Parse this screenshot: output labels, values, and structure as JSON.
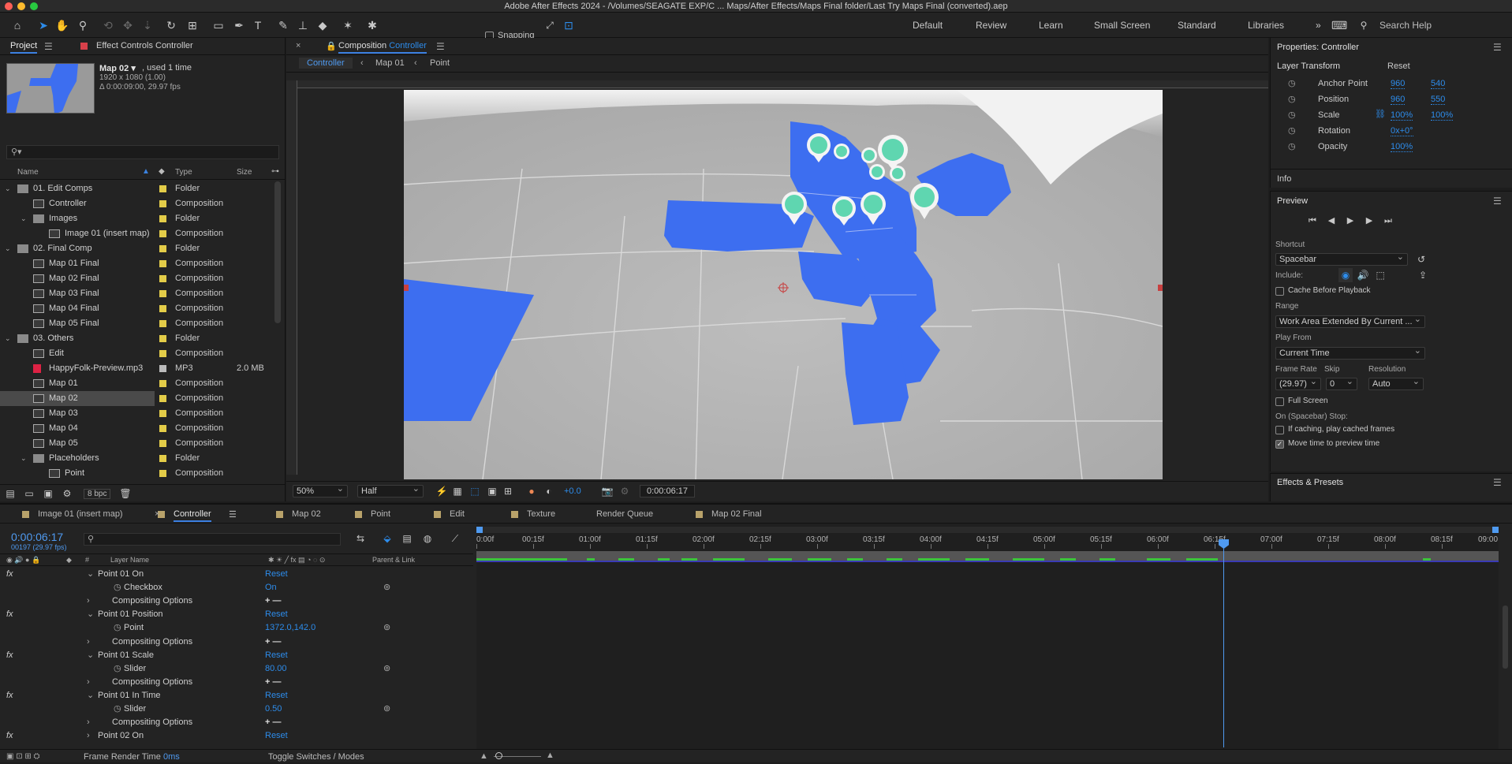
{
  "window": {
    "title": "Adobe After Effects 2024 - /Volumes/SEAGATE EXP/C ... Maps/After Effects/Maps Final folder/Last Try Maps Final (converted).aep"
  },
  "toolbar": {
    "snapping_label": "Snapping",
    "workspaces": [
      "Default",
      "Review",
      "Learn",
      "Small Screen",
      "Standard",
      "Libraries"
    ],
    "search_placeholder": "Search Help"
  },
  "project": {
    "tab_label": "Project",
    "effect_controls_label": "Effect Controls Controller",
    "thumb": {
      "name": "Map 02 ▾",
      "used": ", used 1 time",
      "dims": "1920 x 1080 (1.00)",
      "duration": "Δ 0:00:09:00, 29.97 fps"
    },
    "columns": {
      "name": "Name",
      "type": "Type",
      "size": "Size"
    },
    "items": [
      {
        "name": "01. Edit Comps",
        "type": "Folder",
        "size": "",
        "indent": 0,
        "kind": "folder",
        "arrow": "open"
      },
      {
        "name": "Controller",
        "type": "Composition",
        "size": "",
        "indent": 1,
        "kind": "comp",
        "arrow": ""
      },
      {
        "name": "Images",
        "type": "Folder",
        "size": "",
        "indent": 1,
        "kind": "folder",
        "arrow": "open"
      },
      {
        "name": "Image 01 (insert map)",
        "type": "Composition",
        "size": "",
        "indent": 2,
        "kind": "comp",
        "arrow": ""
      },
      {
        "name": "02. Final Comp",
        "type": "Folder",
        "size": "",
        "indent": 0,
        "kind": "folder",
        "arrow": "open"
      },
      {
        "name": "Map 01 Final",
        "type": "Composition",
        "size": "",
        "indent": 1,
        "kind": "comp",
        "arrow": ""
      },
      {
        "name": "Map 02 Final",
        "type": "Composition",
        "size": "",
        "indent": 1,
        "kind": "comp",
        "arrow": ""
      },
      {
        "name": "Map 03 Final",
        "type": "Composition",
        "size": "",
        "indent": 1,
        "kind": "comp",
        "arrow": ""
      },
      {
        "name": "Map 04 Final",
        "type": "Composition",
        "size": "",
        "indent": 1,
        "kind": "comp",
        "arrow": ""
      },
      {
        "name": "Map 05 Final",
        "type": "Composition",
        "size": "",
        "indent": 1,
        "kind": "comp",
        "arrow": ""
      },
      {
        "name": "03. Others",
        "type": "Folder",
        "size": "",
        "indent": 0,
        "kind": "folder",
        "arrow": "open"
      },
      {
        "name": "Edit",
        "type": "Composition",
        "size": "",
        "indent": 1,
        "kind": "comp",
        "arrow": ""
      },
      {
        "name": "HappyFolk-Preview.mp3",
        "type": "MP3",
        "size": "2.0 MB",
        "indent": 1,
        "kind": "audio",
        "arrow": ""
      },
      {
        "name": "Map 01",
        "type": "Composition",
        "size": "",
        "indent": 1,
        "kind": "comp",
        "arrow": ""
      },
      {
        "name": "Map 02",
        "type": "Composition",
        "size": "",
        "indent": 1,
        "kind": "comp",
        "arrow": "",
        "selected": true
      },
      {
        "name": "Map 03",
        "type": "Composition",
        "size": "",
        "indent": 1,
        "kind": "comp",
        "arrow": ""
      },
      {
        "name": "Map 04",
        "type": "Composition",
        "size": "",
        "indent": 1,
        "kind": "comp",
        "arrow": ""
      },
      {
        "name": "Map 05",
        "type": "Composition",
        "size": "",
        "indent": 1,
        "kind": "comp",
        "arrow": ""
      },
      {
        "name": "Placeholders",
        "type": "Folder",
        "size": "",
        "indent": 1,
        "kind": "folder",
        "arrow": "open"
      },
      {
        "name": "Point",
        "type": "Composition",
        "size": "",
        "indent": 2,
        "kind": "comp",
        "arrow": ""
      }
    ],
    "bpc": "8 bpc"
  },
  "composition": {
    "tab_prefix": "Composition",
    "tab_name": "Controller",
    "breadcrumbs": [
      "Controller",
      "Map 01",
      "Point"
    ],
    "zoom": "50%",
    "resolution": "Half",
    "exposure": "+0.0",
    "timecode": "0:00:06:17"
  },
  "properties": {
    "title": "Properties: Controller",
    "section": "Layer Transform",
    "reset": "Reset",
    "rows": [
      {
        "label": "Anchor Point",
        "v1": "960",
        "v2": "540"
      },
      {
        "label": "Position",
        "v1": "960",
        "v2": "550"
      },
      {
        "label": "Scale",
        "v1": "100%",
        "v2": "100%"
      },
      {
        "label": "Rotation",
        "v1": "0x+0°",
        "v2": ""
      },
      {
        "label": "Opacity",
        "v1": "100%",
        "v2": ""
      }
    ],
    "info_label": "Info"
  },
  "preview": {
    "title": "Preview",
    "shortcut_label": "Shortcut",
    "shortcut_value": "Spacebar",
    "include_label": "Include:",
    "cache_label": "Cache Before Playback",
    "range_label": "Range",
    "range_value": "Work Area Extended By Current ...",
    "play_from_label": "Play From",
    "play_from_value": "Current Time",
    "frame_rate_label": "Frame Rate",
    "skip_label": "Skip",
    "resolution_label": "Resolution",
    "frame_rate_value": "(29.97)",
    "skip_value": "0",
    "resolution_value": "Auto",
    "full_screen_label": "Full Screen",
    "stop_label": "On (Spacebar) Stop:",
    "caching_label": "If caching, play cached frames",
    "move_time_label": "Move time to preview time",
    "effects_label": "Effects & Presets"
  },
  "timeline": {
    "tabs": [
      "Image 01 (insert map)",
      "Controller",
      "Map 02",
      "Point",
      "Edit",
      "Texture",
      "Render Queue",
      "Map 02 Final"
    ],
    "current_time": "0:00:06:17",
    "frame_info": "00197 (29.97 fps)",
    "columns": {
      "layer_name": "Layer Name",
      "parent": "Parent & Link"
    },
    "ruler": [
      "0:00f",
      "00:15f",
      "01:00f",
      "01:15f",
      "02:00f",
      "02:15f",
      "03:00f",
      "03:15f",
      "04:00f",
      "04:15f",
      "05:00f",
      "05:15f",
      "06:00f",
      "06:15f",
      "07:00f",
      "07:15f",
      "08:00f",
      "08:15f",
      "09:00"
    ],
    "rows": [
      {
        "fx": true,
        "indent": 1,
        "arrow": "open",
        "name": "Point 01 On",
        "value": "Reset",
        "link": false
      },
      {
        "fx": false,
        "indent": 2,
        "arrow": "stopwatch",
        "name": "Checkbox",
        "value": "On",
        "link": true
      },
      {
        "fx": false,
        "indent": 1,
        "arrow": "closed",
        "name": "Compositing Options",
        "value": "+ —",
        "link": false
      },
      {
        "fx": true,
        "indent": 1,
        "arrow": "open",
        "name": "Point 01 Position",
        "value": "Reset",
        "link": false
      },
      {
        "fx": false,
        "indent": 2,
        "arrow": "stopwatch",
        "name": "Point",
        "value": "1372.0,142.0",
        "link": true
      },
      {
        "fx": false,
        "indent": 1,
        "arrow": "closed",
        "name": "Compositing Options",
        "value": "+ —",
        "link": false
      },
      {
        "fx": true,
        "indent": 1,
        "arrow": "open",
        "name": "Point 01 Scale",
        "value": "Reset",
        "link": false
      },
      {
        "fx": false,
        "indent": 2,
        "arrow": "stopwatch",
        "name": "Slider",
        "value": "80.00",
        "link": true
      },
      {
        "fx": false,
        "indent": 1,
        "arrow": "closed",
        "name": "Compositing Options",
        "value": "+ —",
        "link": false
      },
      {
        "fx": true,
        "indent": 1,
        "arrow": "open",
        "name": "Point 01 In Time",
        "value": "Reset",
        "link": false
      },
      {
        "fx": false,
        "indent": 2,
        "arrow": "stopwatch",
        "name": "Slider",
        "value": "0.50",
        "link": true
      },
      {
        "fx": false,
        "indent": 1,
        "arrow": "closed",
        "name": "Compositing Options",
        "value": "+ —",
        "link": false
      },
      {
        "fx": true,
        "indent": 1,
        "arrow": "closed",
        "name": "Point 02 On",
        "value": "Reset",
        "link": false
      }
    ],
    "footer": {
      "render_label": "Frame Render Time",
      "render_value": "0ms",
      "toggle_label": "Toggle Switches / Modes"
    }
  },
  "colors": {
    "accent": "#2d8ceb",
    "map_blue": "#3d6ef0",
    "pin_green": "#5fd6b0",
    "folder": "#e3cc48",
    "comp": "#c7c7c7"
  }
}
